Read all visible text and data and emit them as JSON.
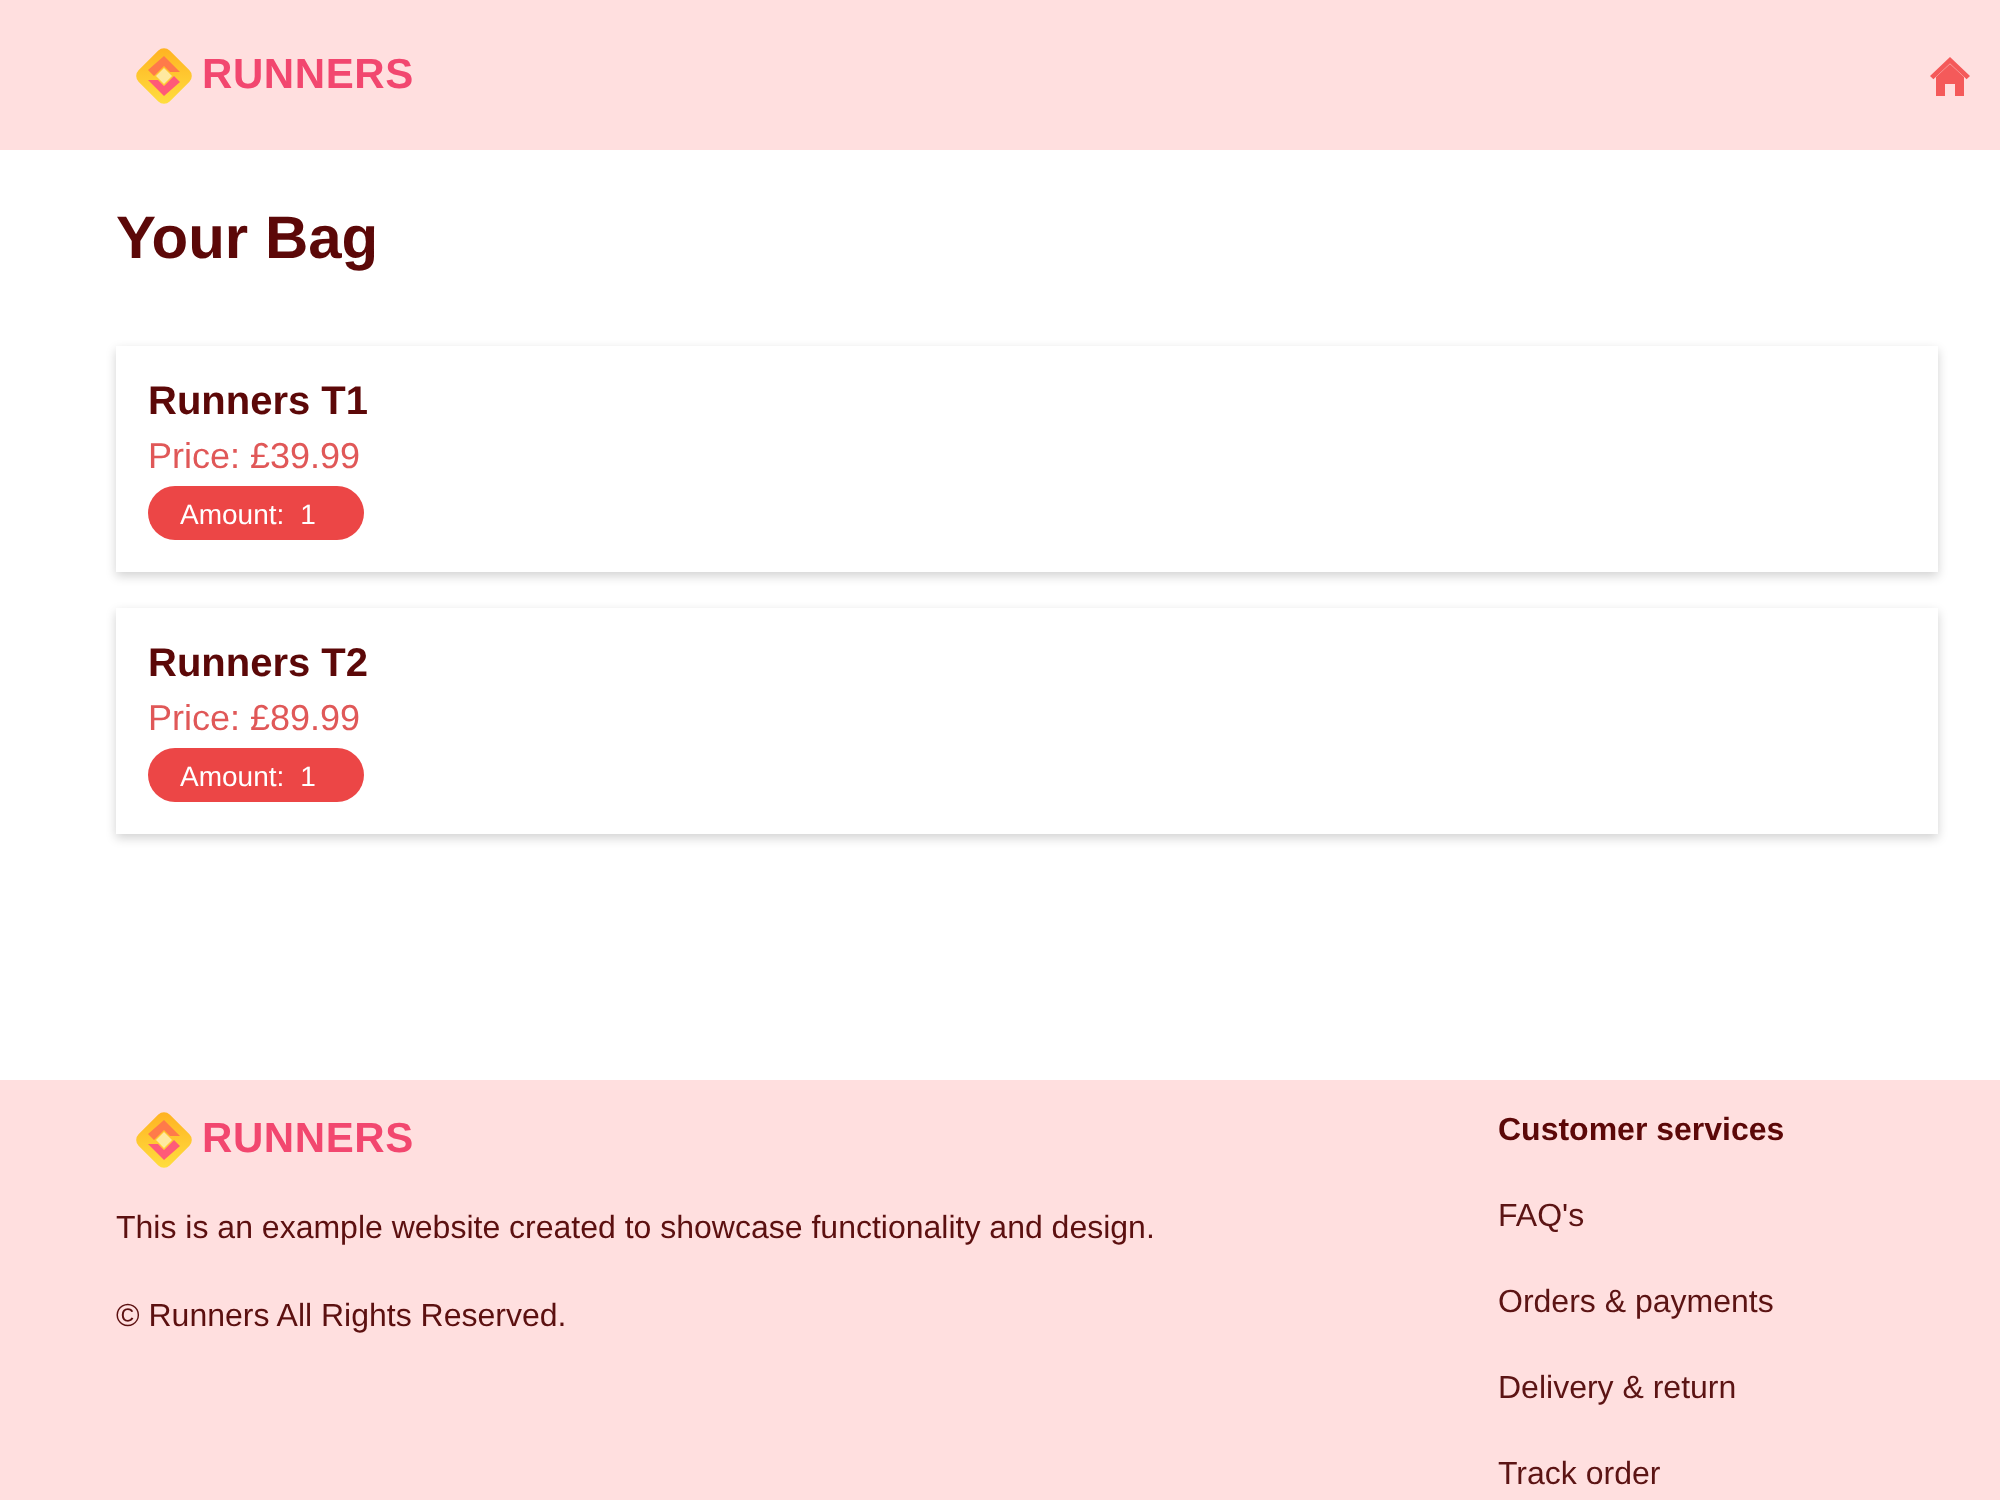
{
  "header": {
    "logo_text": "RUNNERS"
  },
  "page": {
    "title": "Your Bag"
  },
  "bag_items": [
    {
      "name": "Runners T1",
      "price": "Price: £39.99",
      "amount_label": "Amount:",
      "amount": "1"
    },
    {
      "name": "Runners T2",
      "price": "Price: £89.99",
      "amount_label": "Amount:",
      "amount": "1"
    }
  ],
  "footer": {
    "logo_text": "RUNNERS",
    "description": "This is an example website created to showcase functionality and design.",
    "copyright": "© Runners All Rights Reserved.",
    "links_heading": "Customer services",
    "links": [
      "FAQ's",
      "Orders & payments",
      "Delivery & return",
      "Track order"
    ]
  }
}
